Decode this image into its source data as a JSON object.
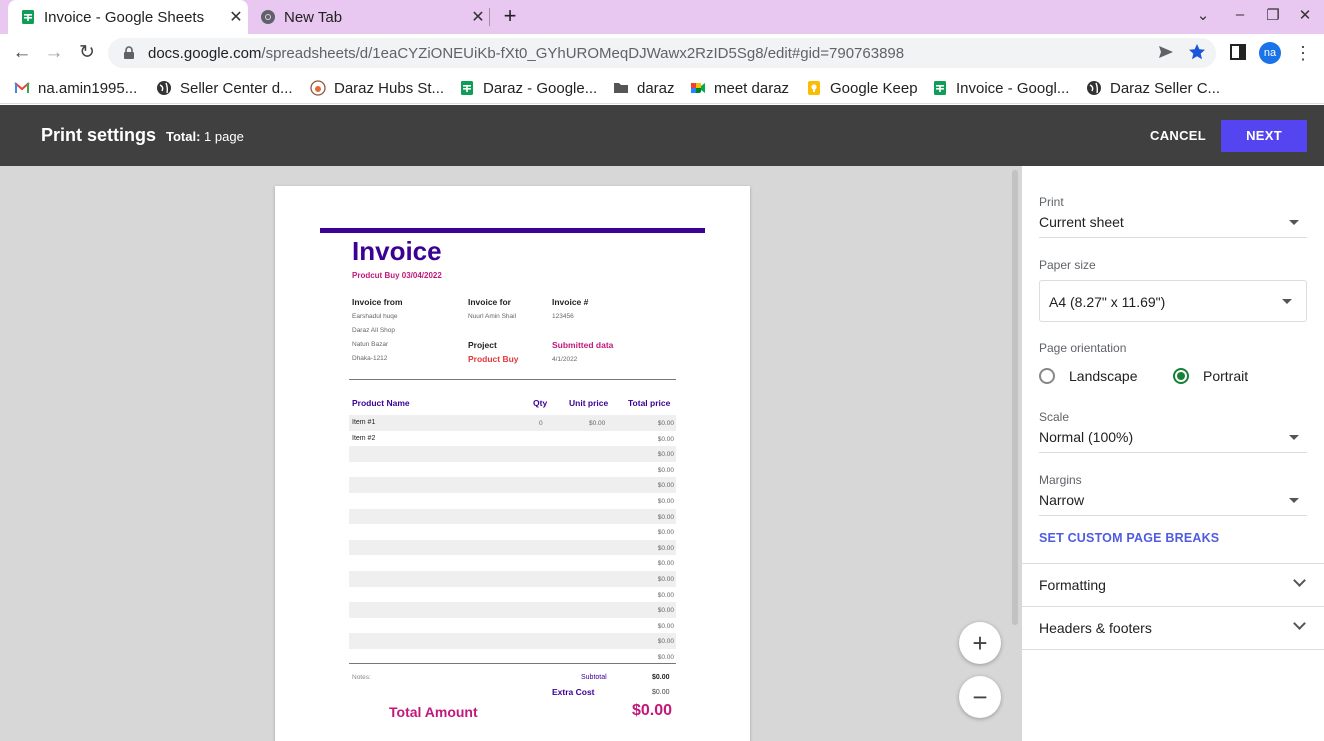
{
  "browser": {
    "tabs": [
      {
        "title": "Invoice - Google Sheets",
        "active": true,
        "icon": "sheets-icon"
      },
      {
        "title": "New Tab",
        "active": false,
        "icon": "chrome-icon"
      }
    ],
    "close_glyph": "✕",
    "new_tab_glyph": "+",
    "url_host": "docs.google.com",
    "url_path": "/spreadsheets/d/1eaCYZiONEUiKb-fXt0_GYhUROMeqDJWawx2RzID5Sg8/edit#gid=790763898",
    "avatar_initials": "na",
    "bookmarks": [
      "na.amin1995...",
      "Seller Center d...",
      "Daraz Hubs St...",
      "Daraz - Google...",
      "daraz",
      "meet daraz",
      "Google Keep",
      "Invoice - Googl...",
      "Daraz Seller C..."
    ]
  },
  "print_header": {
    "title": "Print settings",
    "total_label": "Total:",
    "total_value": "1 page",
    "cancel_label": "CANCEL",
    "next_label": "NEXT",
    "accent_color": "#5445f0"
  },
  "invoice": {
    "title": "Invoice",
    "subtitle": "Prodcut Buy 03/04/2022",
    "from_label": "Invoice from",
    "from_lines": [
      "Earshadul huqe",
      "Daraz All Shop",
      "Natun Bazar",
      "Dhaka-1212"
    ],
    "for_label": "Invoice for",
    "for_value": "Nuurl Amin Shail",
    "number_label": "Invoice #",
    "number_value": "123456",
    "project_label": "Project",
    "project_value": "Product Buy",
    "submitted_label": "Submitted data",
    "submitted_value": "4/1/2022",
    "columns": [
      "Product Name",
      "Qty",
      "Unit price",
      "Total price"
    ],
    "rows": [
      {
        "name": "Item #1",
        "qty": "0",
        "unit": "$0.00",
        "total": "$0.00"
      },
      {
        "name": "Item #2",
        "qty": "",
        "unit": "",
        "total": "$0.00"
      },
      {
        "name": "",
        "qty": "",
        "unit": "",
        "total": "$0.00"
      },
      {
        "name": "",
        "qty": "",
        "unit": "",
        "total": "$0.00"
      },
      {
        "name": "",
        "qty": "",
        "unit": "",
        "total": "$0.00"
      },
      {
        "name": "",
        "qty": "",
        "unit": "",
        "total": "$0.00"
      },
      {
        "name": "",
        "qty": "",
        "unit": "",
        "total": "$0.00"
      },
      {
        "name": "",
        "qty": "",
        "unit": "",
        "total": "$0.00"
      },
      {
        "name": "",
        "qty": "",
        "unit": "",
        "total": "$0.00"
      },
      {
        "name": "",
        "qty": "",
        "unit": "",
        "total": "$0.00"
      },
      {
        "name": "",
        "qty": "",
        "unit": "",
        "total": "$0.00"
      },
      {
        "name": "",
        "qty": "",
        "unit": "",
        "total": "$0.00"
      },
      {
        "name": "",
        "qty": "",
        "unit": "",
        "total": "$0.00"
      },
      {
        "name": "",
        "qty": "",
        "unit": "",
        "total": "$0.00"
      },
      {
        "name": "",
        "qty": "",
        "unit": "",
        "total": "$0.00"
      },
      {
        "name": "",
        "qty": "",
        "unit": "",
        "total": "$0.00"
      }
    ],
    "notes_label": "Notes:",
    "subtotal_label": "Subtotal",
    "subtotal_value": "$0.00",
    "extra_label": "Extra Cost",
    "extra_value": "$0.00",
    "total_label": "Total Amount",
    "total_value": "$0.00",
    "primary_color": "#3b0094",
    "accent_color": "#c2187a"
  },
  "zoom": {
    "in_glyph": "+",
    "out_glyph": "−"
  },
  "settings": {
    "print_label": "Print",
    "print_value": "Current sheet",
    "paper_label": "Paper size",
    "paper_value": "A4 (8.27\" x 11.69\")",
    "orientation_label": "Page orientation",
    "landscape_label": "Landscape",
    "portrait_label": "Portrait",
    "orientation_selected": "Portrait",
    "scale_label": "Scale",
    "scale_value": "Normal (100%)",
    "margins_label": "Margins",
    "margins_value": "Narrow",
    "custom_breaks_label": "SET CUSTOM PAGE BREAKS",
    "formatting_label": "Formatting",
    "headers_label": "Headers & footers"
  }
}
